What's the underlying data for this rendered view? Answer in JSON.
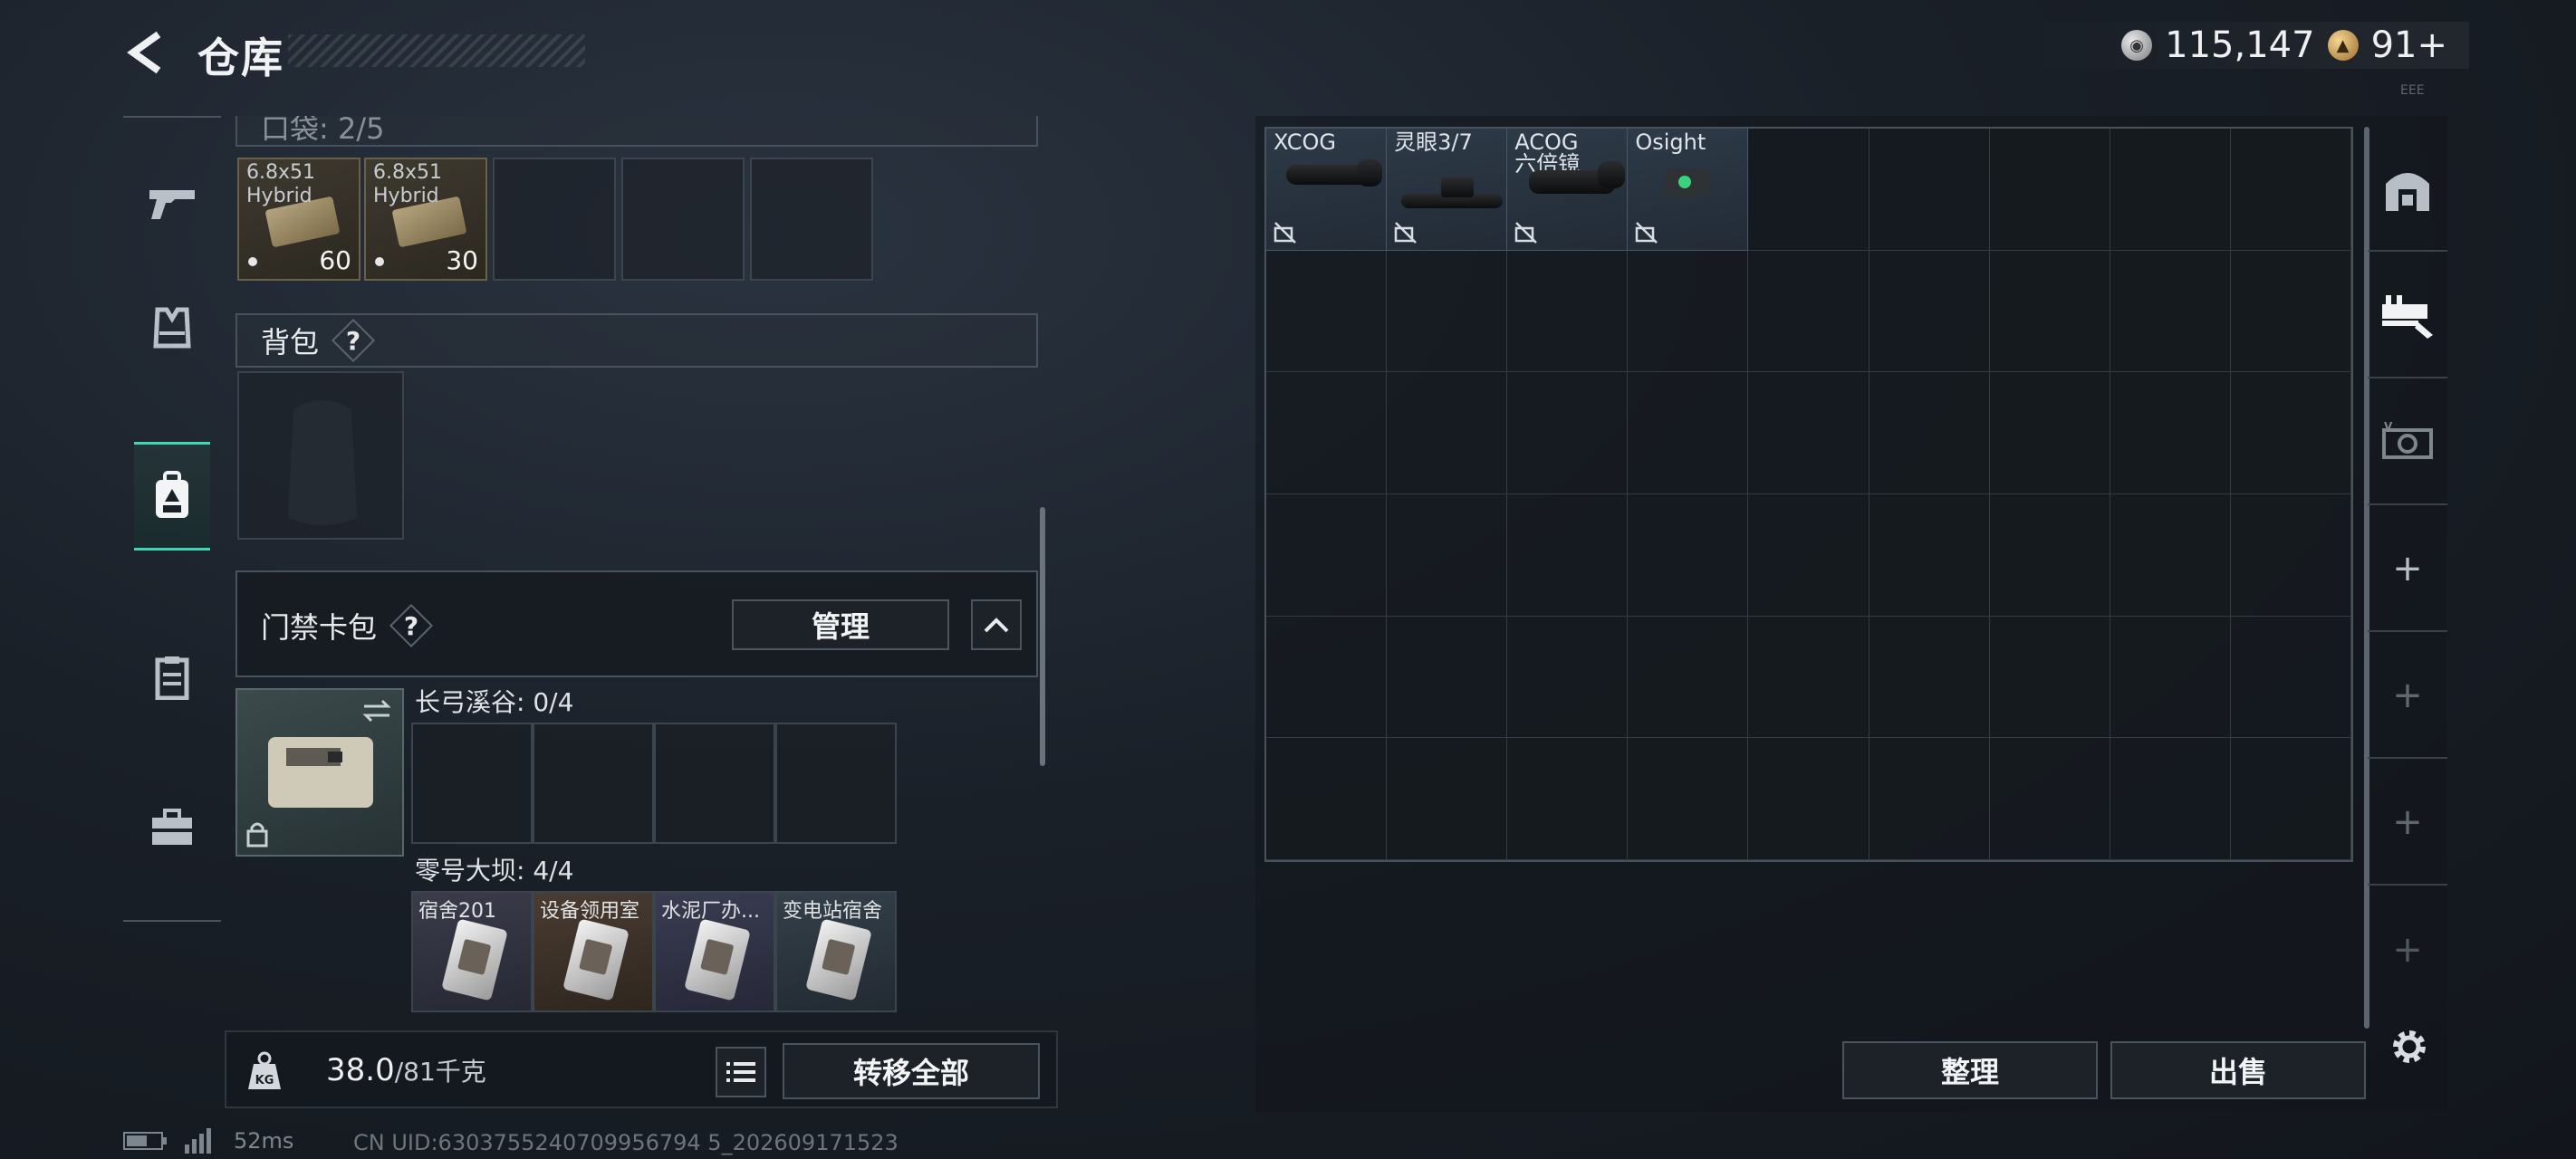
{
  "header": {
    "title": "仓库",
    "currency": [
      {
        "icon": "silver-coin-icon",
        "value": "115,147"
      },
      {
        "icon": "gold-coin-icon",
        "value": "91+"
      }
    ]
  },
  "left_nav": [
    {
      "icon": "pistol-icon",
      "active": false
    },
    {
      "icon": "vest-icon",
      "active": false
    },
    {
      "icon": "backpack-icon",
      "active": true
    },
    {
      "icon": "clipboard-icon",
      "active": false
    },
    {
      "icon": "toolbox-icon",
      "active": false
    }
  ],
  "pockets": {
    "label": "口袋: 2/5",
    "items": [
      {
        "name": "6.8x51 Hybrid",
        "count": "60"
      },
      {
        "name": "6.8x51 Hybrid",
        "count": "30"
      }
    ]
  },
  "backpack": {
    "label": "背包",
    "help": "?"
  },
  "keycard": {
    "label": "门禁卡包",
    "help": "?",
    "manage": "管理",
    "regions": [
      {
        "name": "长弓溪谷: 0/4",
        "cards": [
          "",
          "",
          "",
          ""
        ]
      },
      {
        "name": "零号大坝: 4/4",
        "cards": [
          "宿舍201",
          "设备领用室",
          "水泥厂办...",
          "变电站宿舍"
        ]
      }
    ]
  },
  "weight": {
    "current": "38.0",
    "max": "/81千克",
    "kg_label": "KG"
  },
  "transfer_all": "转移全部",
  "stash": {
    "items": [
      {
        "line1": "XCOG",
        "line2": ""
      },
      {
        "line1": "灵眼3/7",
        "line2": ""
      },
      {
        "line1": "ACOG",
        "line2": "六倍镜"
      },
      {
        "line1": "Osight",
        "line2": ""
      }
    ],
    "sort": "整理",
    "sell": "出售"
  },
  "right_tabs": [
    "vehicle-icon",
    "rifle-mod-icon",
    "attachment-icon",
    "+",
    "+",
    "+",
    "+"
  ],
  "status": {
    "ping": "52ms",
    "uid": "CN UID:6303755240709956794 5_202609171523"
  },
  "tiny_label": "EEE"
}
